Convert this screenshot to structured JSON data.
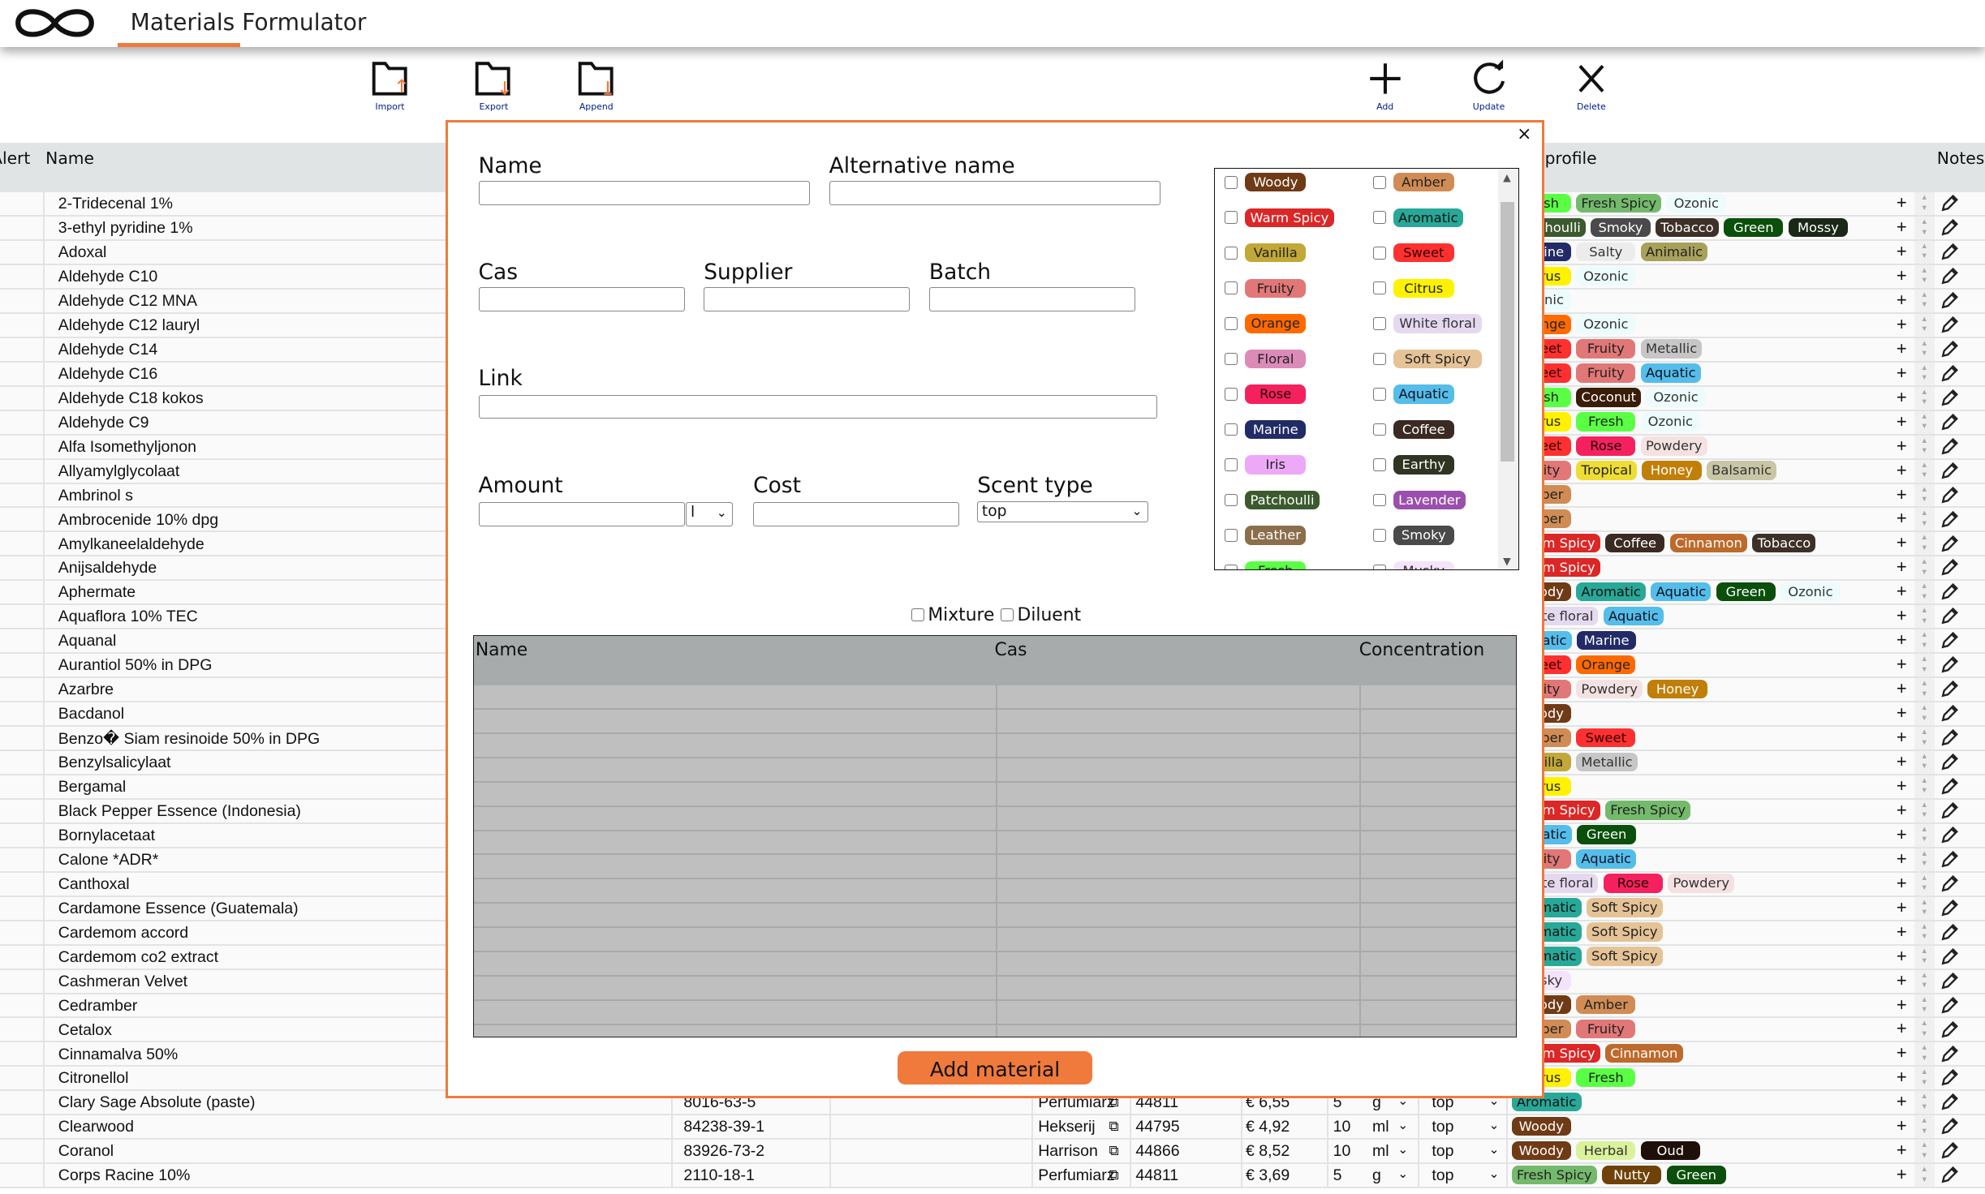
{
  "app": {
    "title": "Materials Formulator"
  },
  "toolbar": [
    {
      "label": "Import",
      "icon": "folder-import-icon"
    },
    {
      "label": "Export",
      "icon": "folder-export-icon"
    },
    {
      "label": "Append",
      "icon": "folder-append-icon"
    },
    {
      "label": "Add",
      "icon": "plus-icon"
    },
    {
      "label": "Update",
      "icon": "refresh-icon"
    },
    {
      "label": "Delete",
      "icon": "close-icon"
    }
  ],
  "table": {
    "headers": {
      "alert": "Alert",
      "name": "Name",
      "profile": "Smell profile",
      "notes": "Notes"
    },
    "rows": [
      {
        "name": "2-Tridecenal 1%",
        "profile": [
          "Fresh",
          "Fresh Spicy",
          "Ozonic"
        ]
      },
      {
        "name": "3-ethyl pyridine 1%",
        "profile": [
          "Patchoulli",
          "Smoky",
          "Tobacco",
          "Green",
          "Mossy"
        ]
      },
      {
        "name": "Adoxal",
        "profile": [
          "Marine",
          "Salty",
          "Animalic"
        ]
      },
      {
        "name": "Aldehyde C10",
        "profile": [
          "Citrus",
          "Ozonic"
        ]
      },
      {
        "name": "Aldehyde C12 MNA",
        "profile": [
          "Ozonic"
        ]
      },
      {
        "name": "Aldehyde C12 lauryl",
        "profile": [
          "Orange",
          "Ozonic"
        ]
      },
      {
        "name": "Aldehyde C14",
        "profile": [
          "Sweet",
          "Fruity",
          "Metallic"
        ]
      },
      {
        "name": "Aldehyde C16",
        "profile": [
          "Sweet",
          "Fruity",
          "Aquatic"
        ]
      },
      {
        "name": "Aldehyde C18 kokos",
        "profile": [
          "Fresh",
          "Coconut",
          "Ozonic"
        ]
      },
      {
        "name": "Aldehyde C9",
        "profile": [
          "Citrus",
          "Fresh",
          "Ozonic"
        ]
      },
      {
        "name": "Alfa Isomethyljonon",
        "profile": [
          "Sweet",
          "Rose",
          "Powdery"
        ]
      },
      {
        "name": "Allyamylglycolaat",
        "profile": [
          "Fruity",
          "Tropical",
          "Honey",
          "Balsamic"
        ]
      },
      {
        "name": "Ambrinol s",
        "profile": [
          "Amber"
        ]
      },
      {
        "name": "Ambrocenide 10% dpg",
        "profile": [
          "Amber"
        ]
      },
      {
        "name": "Amylkaneelaldehyde",
        "profile": [
          "Warm Spicy",
          "Coffee",
          "Cinnamon",
          "Tobacco"
        ]
      },
      {
        "name": "Anijsaldehyde",
        "profile": [
          "Warm Spicy"
        ]
      },
      {
        "name": "Aphermate",
        "profile": [
          "Woody",
          "Aromatic",
          "Aquatic",
          "Green",
          "Ozonic"
        ]
      },
      {
        "name": "Aquaflora 10% TEC",
        "profile": [
          "White floral",
          "Aquatic"
        ]
      },
      {
        "name": "Aquanal",
        "profile": [
          "Aquatic",
          "Marine"
        ]
      },
      {
        "name": "Aurantiol 50% in DPG",
        "profile": [
          "Sweet",
          "Orange"
        ]
      },
      {
        "name": "Azarbre",
        "profile": [
          "Fruity",
          "Powdery",
          "Honey"
        ]
      },
      {
        "name": "Bacdanol",
        "profile": [
          "Woody"
        ]
      },
      {
        "name": "Benzo� Siam resinoide 50% in DPG",
        "profile": [
          "Amber",
          "Sweet"
        ]
      },
      {
        "name": "Benzylsalicylaat",
        "profile": [
          "Vanilla",
          "Metallic"
        ]
      },
      {
        "name": "Bergamal",
        "profile": [
          "Citrus"
        ]
      },
      {
        "name": "Black Pepper Essence (Indonesia)",
        "profile": [
          "Warm Spicy",
          "Fresh Spicy"
        ]
      },
      {
        "name": "Bornylacetaat",
        "profile": [
          "Aquatic",
          "Green"
        ]
      },
      {
        "name": "Calone *ADR*",
        "profile": [
          "Fruity",
          "Aquatic"
        ]
      },
      {
        "name": "Canthoxal",
        "profile": [
          "White floral",
          "Rose",
          "Powdery"
        ]
      },
      {
        "name": "Cardamone Essence (Guatemala)",
        "profile": [
          "Aromatic",
          "Soft Spicy"
        ]
      },
      {
        "name": "Cardemom accord",
        "profile": [
          "Aromatic",
          "Soft Spicy"
        ]
      },
      {
        "name": "Cardemom co2 extract",
        "profile": [
          "Aromatic",
          "Soft Spicy"
        ]
      },
      {
        "name": "Cashmeran Velvet",
        "profile": [
          "Musky"
        ]
      },
      {
        "name": "Cedramber",
        "profile": [
          "Woody",
          "Amber"
        ]
      },
      {
        "name": "Cetalox",
        "profile": [
          "Amber",
          "Fruity"
        ]
      },
      {
        "name": "Cinnamalva 50%",
        "profile": [
          "Warm Spicy",
          "Cinnamon"
        ]
      },
      {
        "name": "Citronellol",
        "profile": [
          "Citrus",
          "Fresh"
        ]
      },
      {
        "name": "Clary Sage Absolute (paste)",
        "cas": "8016-63-5",
        "supplier": "Perfumiarz",
        "batch": "44811",
        "cost": "€ 6,55",
        "amount": "5",
        "unit": "g",
        "scent_type": "top",
        "profile": [
          "Aromatic"
        ]
      },
      {
        "name": "Clearwood",
        "cas": "84238-39-1",
        "supplier": "Hekserij",
        "batch": "44795",
        "cost": "€ 4,92",
        "amount": "10",
        "unit": "ml",
        "scent_type": "top",
        "profile": [
          "Woody"
        ]
      },
      {
        "name": "Coranol",
        "cas": "83926-73-2",
        "supplier": "Harrison",
        "batch": "44866",
        "cost": "€ 8,52",
        "amount": "10",
        "unit": "ml",
        "scent_type": "top",
        "profile": [
          "Woody",
          "Herbal",
          "Oud"
        ]
      },
      {
        "name": "Corps Racine 10%",
        "cas": "2110-18-1",
        "supplier": "Perfumiarz",
        "batch": "44811",
        "cost": "€ 3,69",
        "amount": "5",
        "unit": "g",
        "scent_type": "top",
        "profile": [
          "Fresh Spicy",
          "Nutty",
          "Green"
        ]
      }
    ]
  },
  "modal": {
    "labels": {
      "name": "Name",
      "alt_name": "Alternative name",
      "cas": "Cas",
      "supplier": "Supplier",
      "batch": "Batch",
      "link": "Link",
      "amount": "Amount",
      "cost": "Cost",
      "scent_type": "Scent type"
    },
    "values": {
      "name": "",
      "alt_name": "",
      "cas": "",
      "supplier": "",
      "batch": "",
      "link": "",
      "amount": "",
      "cost": ""
    },
    "unit_selected": "l",
    "scent_type_selected": "top",
    "close_label": "×",
    "scent_options": [
      "Woody",
      "Amber",
      "Warm Spicy",
      "Aromatic",
      "Vanilla",
      "Sweet",
      "Fruity",
      "Citrus",
      "Orange",
      "White floral",
      "Floral",
      "Soft Spicy",
      "Rose",
      "Aquatic",
      "Marine",
      "Coffee",
      "Iris",
      "Earthy",
      "Patchoulli",
      "Lavender",
      "Leather",
      "Smoky",
      "Fresh",
      "Musky"
    ],
    "mixture_label": "Mixture",
    "diluent_label": "Diluent",
    "mixture_table": {
      "headers": [
        "Name",
        "Cas",
        "Concentration"
      ]
    },
    "add_button": "Add material"
  },
  "colors": {
    "accent": "#ef7a3c",
    "tags": {
      "Woody": [
        "#6f3b16",
        "#fff"
      ],
      "Amber": [
        "#d08c54",
        "#222"
      ],
      "Warm Spicy": [
        "#dc2727",
        "#fff"
      ],
      "Aromatic": [
        "#27a898",
        "#111"
      ],
      "Vanilla": [
        "#c2a838",
        "#222"
      ],
      "Sweet": [
        "#ff3030",
        "#300"
      ],
      "Fruity": [
        "#e27777",
        "#222"
      ],
      "Citrus": [
        "#fff200",
        "#222"
      ],
      "Orange": [
        "#ff6a00",
        "#222"
      ],
      "White floral": [
        "#e5d9ef",
        "#333"
      ],
      "Floral": [
        "#dc8ab8",
        "#222"
      ],
      "Soft Spicy": [
        "#e5c396",
        "#222"
      ],
      "Rose": [
        "#f5215f",
        "#200"
      ],
      "Aquatic": [
        "#55bde9",
        "#112"
      ],
      "Marine": [
        "#222b66",
        "#fff"
      ],
      "Coffee": [
        "#3b2a22",
        "#fff"
      ],
      "Iris": [
        "#eda8f8",
        "#222"
      ],
      "Earthy": [
        "#2f3522",
        "#fff"
      ],
      "Patchoulli": [
        "#3c5a2e",
        "#fff"
      ],
      "Lavender": [
        "#9b4fac",
        "#fff"
      ],
      "Leather": [
        "#8b6e4b",
        "#fff"
      ],
      "Smoky": [
        "#4a4a4a",
        "#fff"
      ],
      "Fresh": [
        "#5aff45",
        "#222"
      ],
      "Musky": [
        "#f5e3fb",
        "#333"
      ],
      "Fresh Spicy": [
        "#74ba6c",
        "#222"
      ],
      "Ozonic": [
        "#ecfbfb",
        "#333"
      ],
      "Tobacco": [
        "#3d3027",
        "#fff"
      ],
      "Green": [
        "#0a4f0b",
        "#fff"
      ],
      "Mossy": [
        "#1a2818",
        "#fff"
      ],
      "Salty": [
        "#ececec",
        "#333"
      ],
      "Animalic": [
        "#a8a15b",
        "#222"
      ],
      "Metallic": [
        "#c6c6c6",
        "#333"
      ],
      "Coconut": [
        "#3a1d08",
        "#fff"
      ],
      "Powdery": [
        "#f4e2e2",
        "#333"
      ],
      "Tropical": [
        "#eedd33",
        "#222"
      ],
      "Honey": [
        "#c17f07",
        "#fff"
      ],
      "Balsamic": [
        "#c9c6a5",
        "#333"
      ],
      "Cinnamon": [
        "#bd6a2c",
        "#fff"
      ],
      "Herbal": [
        "#d9f29b",
        "#333"
      ],
      "Oud": [
        "#1f0f09",
        "#fff"
      ],
      "Nutty": [
        "#6e4208",
        "#fff"
      ]
    }
  }
}
